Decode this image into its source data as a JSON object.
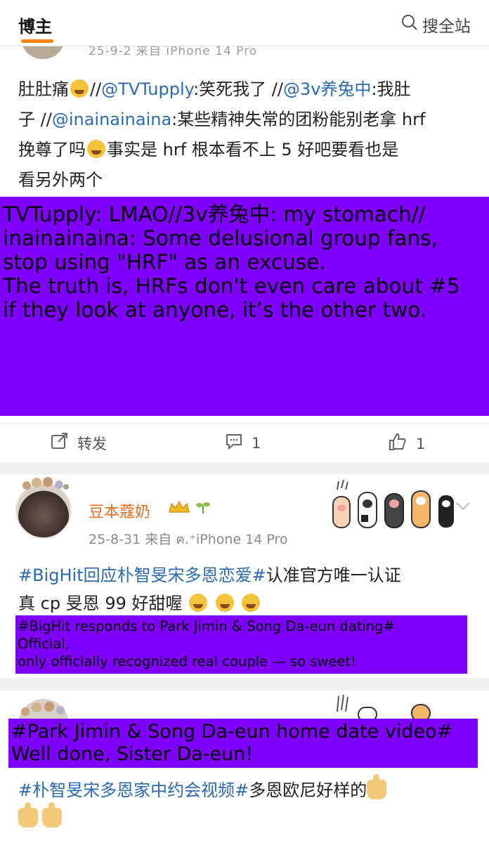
{
  "header": {
    "title": "博主",
    "search_label": "搜全站"
  },
  "post1": {
    "cut_meta": "25-9-2 来自 iPhone 14 Pro",
    "lines": {
      "l1a": "肚肚痛",
      "l1b": "//",
      "m1": "@TVTupply",
      "l1c": ":笑死我了 //",
      "m2": "@3v养兔中",
      "l1d": ":我肚",
      "l2a": "子 //",
      "m3": "@inainainaina",
      "l2b": ":某些精神失常的团粉能别老拿 hrf",
      "l3a": "挽尊了吗",
      "l3b": "事实是 hrf 根本看不上 5 好吧要看也是",
      "l4": "看另外两个"
    },
    "translation": "TVTupply: LMAO//3v养兔中: my stomach//\ninainainaina: Some delusional group fans,\nstop using \"HRF\" as an excuse.\nThe truth is, HRFs don't even care about #5\nif they look at anyone, it’s the other two.",
    "actions": {
      "repost": "转发",
      "comments": "1",
      "likes": "1"
    }
  },
  "post2": {
    "username": "豆本蔻奶",
    "meta": "25-8-31 来自 ฅ.⁺iPhone 14 Pro",
    "hashtag": "#BigHit回应朴智旻宋多恩恋爱#",
    "text_after_hashtag": "认准官方唯一认证",
    "text_line2": "真 cp 旻恩 99 好甜喔",
    "translation": "#BigHit responds to Park Jimin & Song Da-eun dating#\nOfficial,\nonly officially recognized real couple — so sweet!"
  },
  "post3": {
    "translation": "#Park Jimin & Song Da-eun home date video#\nWell done, Sister Da-eun!",
    "hashtag": "#朴智旻宋多恩家中约会视频#",
    "text_after_hashtag": "多恩欧尼好样的"
  },
  "colors": {
    "accent": "#ff8200",
    "link": "#2c6ab0",
    "overlay": "#7f00ff",
    "username": "#e86b1c"
  }
}
